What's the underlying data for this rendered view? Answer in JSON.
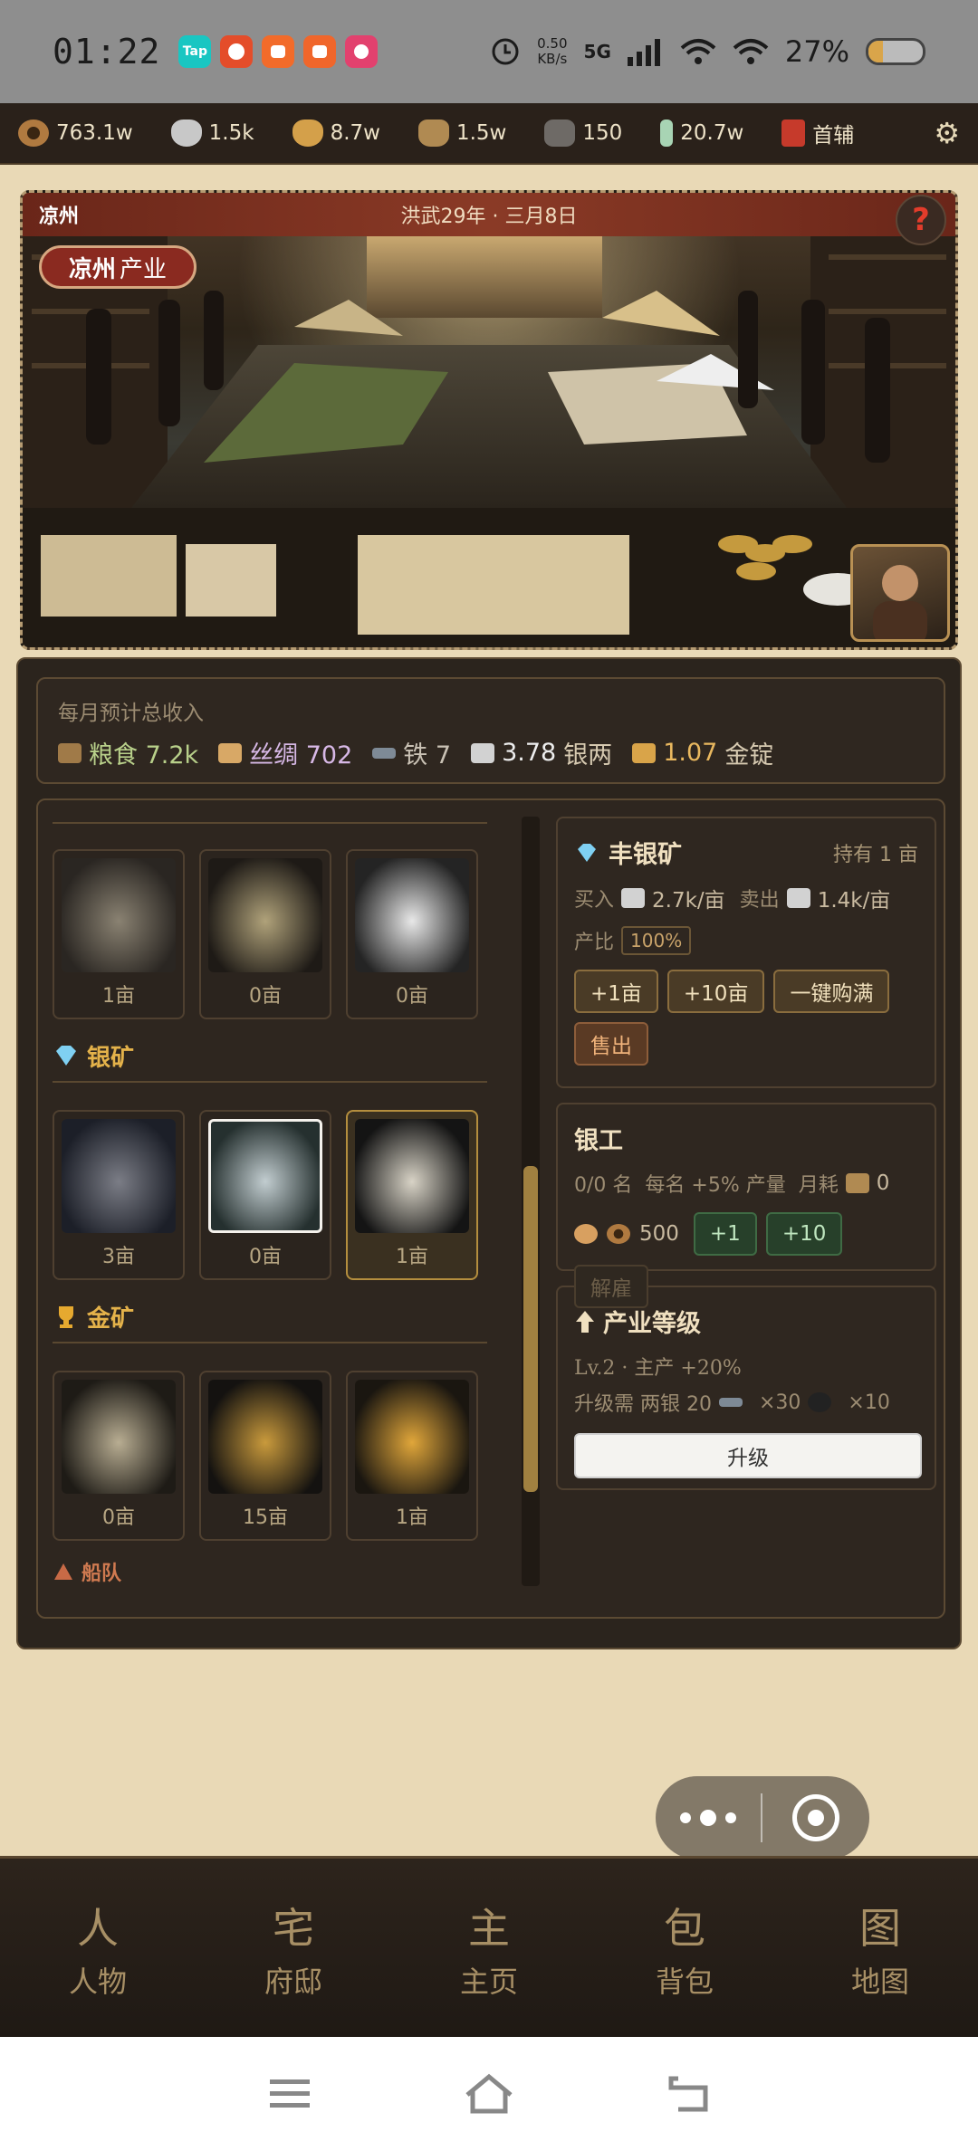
{
  "status_bar": {
    "time": "01:22",
    "apps": [
      {
        "name": "tap-app-icon",
        "label": "Tap",
        "color": "#19c6c2"
      },
      {
        "name": "red-app-icon",
        "label": "",
        "color": "#e44d2a"
      },
      {
        "name": "kuaishou-app-icon",
        "label": "",
        "color": "#f26b2a"
      },
      {
        "name": "kuaishou2-app-icon",
        "label": "",
        "color": "#f0662b"
      },
      {
        "name": "pink-app-icon",
        "label": "",
        "color": "#e2416e"
      }
    ],
    "net_speed": "0.50",
    "net_unit": "KB/s",
    "network": "5G",
    "battery": "27%",
    "battery_level": 0.27
  },
  "resources": [
    {
      "icon": "copper-coin-icon",
      "value": "763.1w",
      "color": "#9a6a3a"
    },
    {
      "icon": "silver-ingot-icon",
      "value": "1.5k",
      "color": "#c8c8c8"
    },
    {
      "icon": "gold-ingot-icon",
      "value": "8.7w",
      "color": "#d4a04a"
    },
    {
      "icon": "grain-sack-icon",
      "value": "1.5w",
      "color": "#b08a52"
    },
    {
      "icon": "ore-icon",
      "value": "150",
      "color": "#6e6a66"
    },
    {
      "icon": "jade-icon",
      "value": "20.7w",
      "color": "#a8d4b4"
    }
  ],
  "rank": {
    "icon": "rank-book-icon",
    "label": "首辅"
  },
  "banner": {
    "city": "凉州",
    "date": "洪武29年 · 三月8日",
    "help": "?",
    "industry_city": "凉州",
    "industry_suffix": "产业"
  },
  "income": {
    "label": "每月预计总收入",
    "grain": "粮食 7.2k",
    "silk": "丝绸 702",
    "iron": "铁 7",
    "silver_value": "3.78",
    "silver_unit": "银两",
    "gold_value": "1.07",
    "gold_unit": "金锭"
  },
  "mines": {
    "top_tiles": [
      {
        "count": "1亩",
        "colors": [
          "#8a8272",
          "#2a2622"
        ]
      },
      {
        "count": "0亩",
        "colors": [
          "#b0a27a",
          "#1e1a16"
        ]
      },
      {
        "count": "0亩",
        "colors": [
          "#e8e8e8",
          "#242424"
        ]
      }
    ],
    "silver_section": "银矿",
    "silver_tiles": [
      {
        "count": "3亩",
        "colors": [
          "#7b7d86",
          "#1c1f28"
        ]
      },
      {
        "count": "0亩",
        "colors": [
          "#c2cdd0",
          "#25302f"
        ]
      },
      {
        "count": "1亩",
        "colors": [
          "#d8d3c6",
          "#141414"
        ]
      }
    ],
    "gold_section": "金矿",
    "gold_tiles": [
      {
        "count": "0亩",
        "colors": [
          "#b8ad92",
          "#1e1b16"
        ]
      },
      {
        "count": "15亩",
        "colors": [
          "#c99a3c",
          "#141210"
        ]
      },
      {
        "count": "1亩",
        "colors": [
          "#e0a63a",
          "#1a1610"
        ]
      }
    ],
    "fleet_section": "船队"
  },
  "detail": {
    "name": "丰银矿",
    "hold": "持有 1 亩",
    "buy_label": "买入",
    "buy_value": "2.7k/亩",
    "sell_label": "卖出",
    "sell_value": "1.4k/亩",
    "ratio_label": "产比",
    "ratio_value": "100%",
    "btn_plus1": "+1亩",
    "btn_plus10": "+10亩",
    "btn_buy_full": "一键购满",
    "btn_sell": "售出"
  },
  "workers": {
    "title": "银工",
    "count": "0/0 名",
    "bonus": "每名 +5% 产量",
    "cost_label": "月耗",
    "cost_value": "0",
    "wage": "500",
    "btn_plus1": "+1",
    "btn_plus10": "+10",
    "btn_fire": "解雇"
  },
  "level": {
    "title": "产业等级",
    "line1": "Lv.2 · 主产 +20%",
    "line2_prefix": "升级需 两银 20",
    "line2_mid": "×30",
    "line2_end": "×10",
    "upgrade": "升级"
  },
  "bottom_nav": [
    {
      "glyph": "人",
      "label": "人物"
    },
    {
      "glyph": "宅",
      "label": "府邸"
    },
    {
      "glyph": "主",
      "label": "主页"
    },
    {
      "glyph": "包",
      "label": "背包"
    },
    {
      "glyph": "图",
      "label": "地图"
    }
  ]
}
